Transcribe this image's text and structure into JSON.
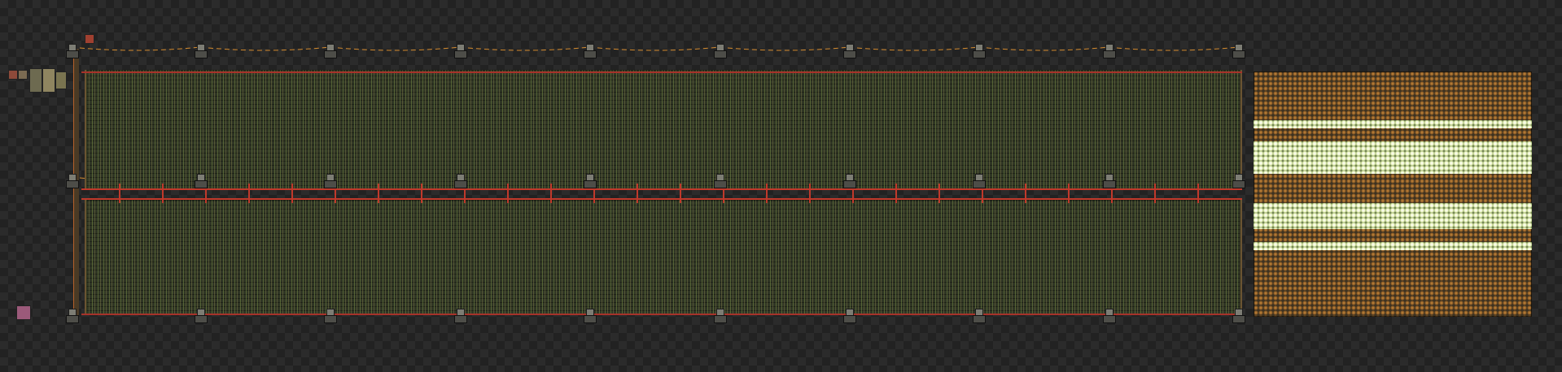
{
  "scene": {
    "view": "blueprint-overview",
    "colors": {
      "background_checker_dark": "#222222",
      "background_checker_light": "#2b2b2b",
      "combinator_field": "#2f3524",
      "red_wire": "#c0392b",
      "green_wire": "#3aa34a",
      "copper_wire": "#d58b2e",
      "lamp_unlit": "#c78a3e",
      "lamp_lit": "#eef5c8",
      "frame": "#6b5432"
    },
    "icons": [
      "electric-pole-icon",
      "constant-combinator-icon",
      "lamp-icon",
      "substation-icon"
    ]
  }
}
